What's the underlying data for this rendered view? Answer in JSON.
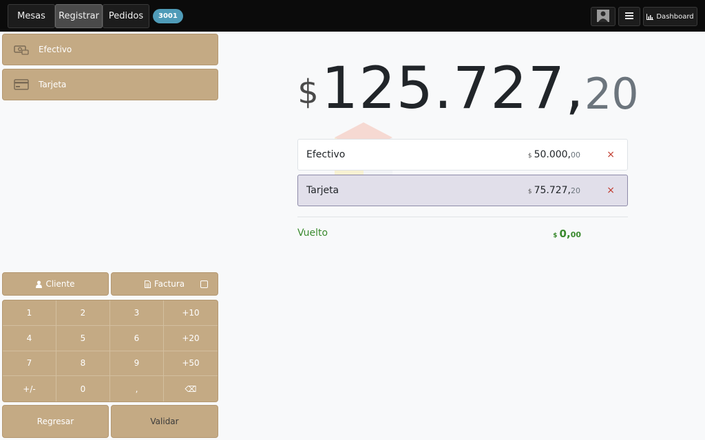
{
  "topbar": {
    "tabs": [
      {
        "label": "Mesas"
      },
      {
        "label": "Registrar"
      },
      {
        "label": "Pedidos"
      }
    ],
    "order_badge": "3001",
    "avatar_icon": "user-avatar-icon",
    "menu_icon": "hamburger-icon",
    "dashboard_label": "Dashboard",
    "dashboard_icon": "bar-chart-icon"
  },
  "payment_methods": [
    {
      "label": "Efectivo",
      "icon": "cash-icon"
    },
    {
      "label": "Tarjeta",
      "icon": "credit-card-icon"
    }
  ],
  "controls": {
    "cliente_label": "Cliente",
    "cliente_icon": "user-icon",
    "factura_label": "Factura",
    "factura_icon": "document-icon",
    "factura_checkbox_icon": "checkbox-icon"
  },
  "numpad": {
    "keys": [
      "1",
      "2",
      "3",
      "+10",
      "4",
      "5",
      "6",
      "+20",
      "7",
      "8",
      "9",
      "+50",
      "+/-",
      "0",
      ",",
      "⌫"
    ]
  },
  "actions": {
    "back_label": "Regresar",
    "validate_label": "Validar"
  },
  "total": {
    "currency": "$",
    "integer": "125.727,",
    "decimal": "20"
  },
  "payment_lines": [
    {
      "name": "Efectivo",
      "currency": "$",
      "integer": "50.000,",
      "decimal": "00",
      "remove": "×"
    },
    {
      "name": "Tarjeta",
      "currency": "$",
      "integer": "75.727,",
      "decimal": "20",
      "remove": "×"
    }
  ],
  "change": {
    "label": "Vuelto",
    "currency": "$",
    "integer": "0,",
    "decimal": "00"
  },
  "colors": {
    "topbar": "#0b0b0b",
    "panel_button": "#c4aa84",
    "selected_line": "#e1dfea",
    "change_text": "#3a8a2e",
    "remove_icon": "#c0392b",
    "badge": "#4f9bb8"
  }
}
